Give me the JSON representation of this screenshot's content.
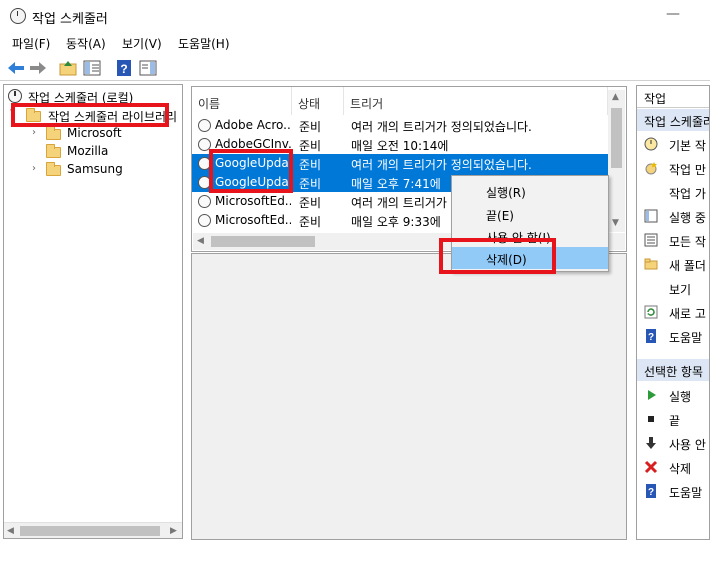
{
  "window": {
    "title": "작업 스케줄러",
    "minimize_glyph": "—"
  },
  "menu": [
    "파일(F)",
    "동작(A)",
    "보기(V)",
    "도움말(H)"
  ],
  "tree": {
    "root": "작업 스케줄러 (로컬)",
    "library": "작업 스케줄러 라이브러리",
    "children": [
      "Microsoft",
      "Mozilla",
      "Samsung"
    ]
  },
  "task_table": {
    "columns": [
      "이름",
      "상태",
      "트리거"
    ],
    "rows": [
      {
        "name": "Adobe Acro...",
        "status": "준비",
        "trigger": "여러 개의 트리거가 정의되었습니다.",
        "selected": false
      },
      {
        "name": "AdobeGCInv...",
        "status": "준비",
        "trigger": "매일 오전 10:14에",
        "selected": false
      },
      {
        "name": "GoogleUpda...",
        "status": "준비",
        "trigger": "여러 개의 트리거가 정의되었습니다.",
        "selected": true
      },
      {
        "name": "GoogleUpda...",
        "status": "준비",
        "trigger": "매일 오후 7:41에",
        "selected": true
      },
      {
        "name": "MicrosoftEd...",
        "status": "준비",
        "trigger": "여러 개의 트리거가 정의되었",
        "selected": false
      },
      {
        "name": "MicrosoftEd...",
        "status": "준비",
        "trigger": "매일 오후 9:33에",
        "selected": false
      }
    ]
  },
  "context_menu": {
    "items": [
      "실행(R)",
      "끝(E)",
      "사용 안 함(I)",
      "삭제(D)"
    ],
    "highlighted": "삭제(D)"
  },
  "actions": {
    "header": "작업",
    "section1": "작업 스케줄러 라이브러리",
    "items1": [
      "기본 작",
      "작업 만",
      "작업 가",
      "실행 중",
      "모든 작",
      "새 폴더",
      "보기",
      "새로 고",
      "도움말"
    ],
    "section2": "선택한 항목",
    "items2": [
      "실행",
      "끝",
      "사용 안",
      "삭제",
      "도움말"
    ]
  },
  "colors": {
    "selection": "#0078d7",
    "highlight_red": "#e8141c",
    "menu_hover": "#91c9f7"
  }
}
